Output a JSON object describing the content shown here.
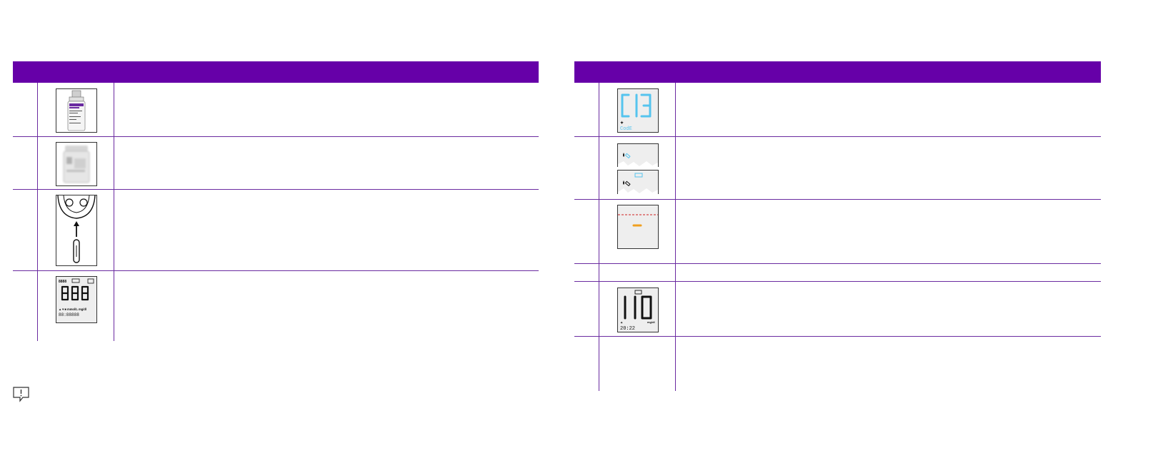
{
  "colors": {
    "header": "#6600a8",
    "rule": "#6a2aa0",
    "lcd_cyan": "#55c4ee",
    "dash_orange": "#f0a020",
    "dash_red": "#d02020"
  },
  "left_table": {
    "header_label": "",
    "rows": [
      {
        "icon": "control-solution-bottle-icon"
      },
      {
        "icon": "test-strip-vial-icon"
      },
      {
        "icon": "meter-strip-insert-icon"
      },
      {
        "icon": "lcd-all-segments-icon"
      }
    ]
  },
  "right_table": {
    "header_label": "",
    "rows": [
      {
        "icon": "lcd-code-icon",
        "lcd_text": "C13",
        "sub_text": "CodE"
      },
      {
        "icon": "lcd-blood-drop-icon"
      },
      {
        "icon": "lcd-dash-icon"
      },
      {
        "icon": ""
      },
      {
        "icon": "lcd-result-icon",
        "lcd_text": "110",
        "unit": "mg/dl",
        "time": "20:22"
      },
      {
        "icon": ""
      }
    ]
  },
  "footer": {
    "icon": "note-icon"
  }
}
